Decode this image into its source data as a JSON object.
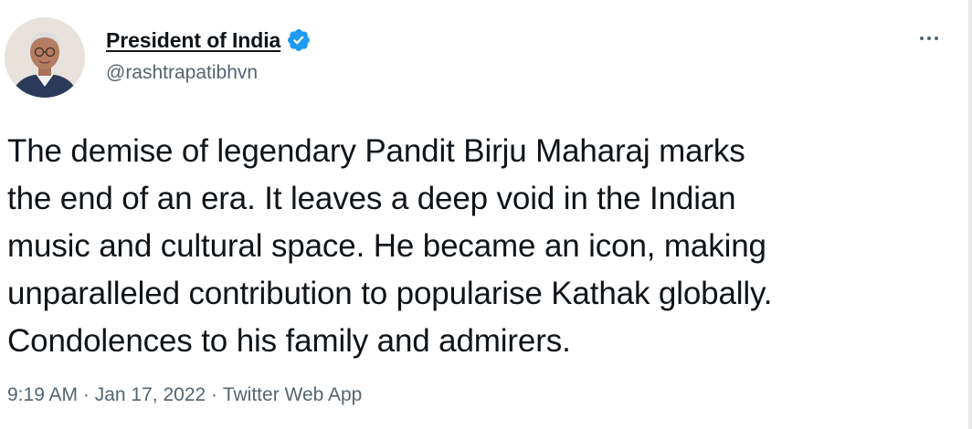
{
  "user": {
    "display_name": "President of India",
    "handle": "@rashtrapatibhvn",
    "verified": true,
    "verified_color": "#1d9bf0"
  },
  "tweet": {
    "text": "The demise of legendary Pandit Birju Maharaj marks\nthe end of an era. It leaves a deep void in the Indian\nmusic and cultural space. He became an icon, making\nunparalleled contribution to popularise Kathak globally.\nCondolences to his family and admirers.",
    "time": "9:19 AM",
    "date": "Jan 17, 2022",
    "source": "Twitter Web App",
    "separator": " · "
  },
  "icons": {
    "avatar": "profile-photo",
    "verified": "verified-badge-icon",
    "more": "more-options-icon"
  },
  "colors": {
    "text_primary": "#0f1419",
    "text_secondary": "#536471",
    "background": "#ffffff"
  }
}
